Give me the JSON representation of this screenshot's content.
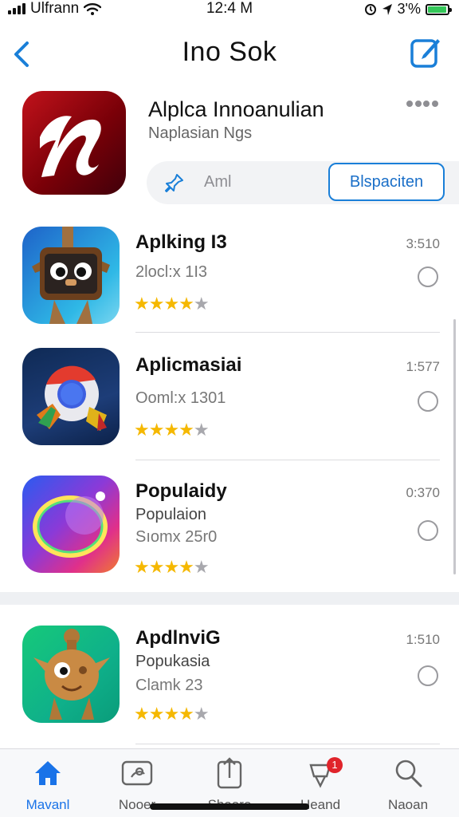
{
  "status_bar": {
    "carrier": "Ulfrann",
    "time": "12:4 M",
    "battery": "3'%",
    "battery_level": 0.95,
    "battery_color": "#34c759"
  },
  "nav": {
    "title": "Ino Sok",
    "accent": "#1a7fd8"
  },
  "featured": {
    "name": "Alplca Innoanulian",
    "subtitle": "Naplasian Ngs",
    "segment_label": "Aml",
    "button_label": "Blspaciten",
    "icon_color": "#b1101a"
  },
  "apps": [
    {
      "name": "Aplking I3",
      "line2": "2locl:x 1I3",
      "time": "3:510",
      "rating": 4,
      "icon": "wooden-robot-icon"
    },
    {
      "name": "Aplicmasiai",
      "line2": "Ooml:x 1301",
      "time": "1:577",
      "rating": 4,
      "icon": "browser-orb-icon"
    },
    {
      "name": "Populaidy",
      "line2": "Populaion",
      "line3": "Sıomx 25r0",
      "time": "0:370",
      "rating": 4,
      "icon": "gradient-ring-icon"
    },
    {
      "name": "ApdlnviG",
      "line2": "Popukasia",
      "line3": "Clamk 23",
      "time": "1:510",
      "rating": 4,
      "icon": "wooden-creature-icon"
    }
  ],
  "tabs": [
    {
      "label": "Mavanl",
      "icon": "home-icon",
      "active": true
    },
    {
      "label": "Nooer",
      "icon": "media-icon",
      "active": false
    },
    {
      "label": "Shaare",
      "icon": "share-icon",
      "active": false
    },
    {
      "label": "Heand",
      "icon": "notifications-icon",
      "active": false,
      "badge": "1"
    },
    {
      "label": "Naoan",
      "icon": "search-icon",
      "active": false
    }
  ],
  "colors": {
    "star": "#f5b800",
    "tab_active": "#1a73e8",
    "badge": "#e0242b"
  }
}
